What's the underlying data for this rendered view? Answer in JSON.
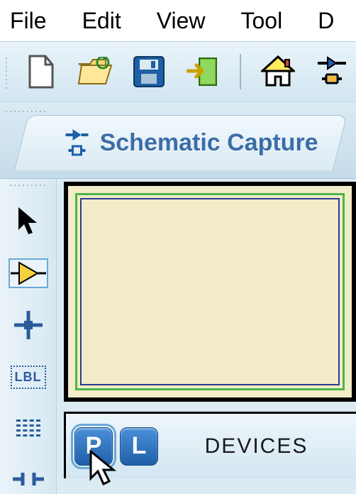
{
  "menubar": {
    "file": "File",
    "edit": "Edit",
    "view": "View",
    "tool": "Tool",
    "d": "D"
  },
  "toolbar": {
    "icons": {
      "new": "new-file-icon",
      "open": "open-folder-icon",
      "save": "save-icon",
      "import": "import-icon",
      "home": "home-icon",
      "component": "component-icon"
    }
  },
  "tab": {
    "label": "Schematic Capture"
  },
  "sidetool": {
    "selection": "selection-icon",
    "component": "component-mode-icon",
    "junction": "junction-icon",
    "label": "LBL",
    "text": "text-icon",
    "bus": "bus-icon"
  },
  "devices": {
    "p": "P",
    "l": "L",
    "title": "DEVICES"
  }
}
